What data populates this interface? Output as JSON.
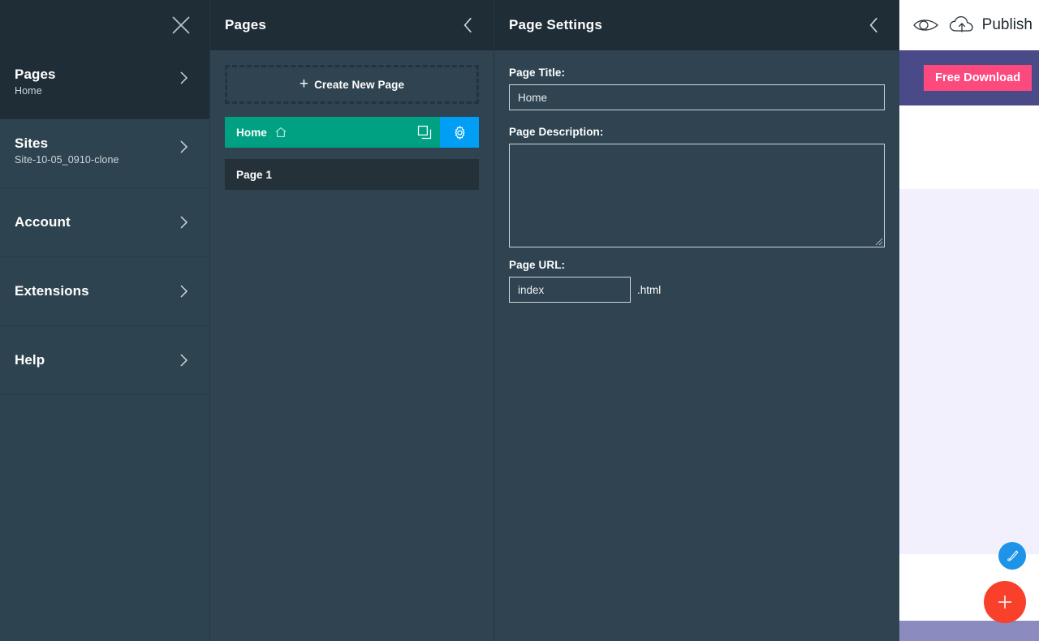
{
  "sidebar": {
    "close_icon": "close-icon",
    "items": [
      {
        "title": "Pages",
        "sub": "Home",
        "icon": "chevron-right-icon",
        "active": true
      },
      {
        "title": "Sites",
        "sub": "Site-10-05_0910-clone",
        "icon": "chevron-right-icon",
        "active": false
      },
      {
        "title": "Account",
        "sub": "",
        "icon": "chevron-right-icon",
        "active": false
      },
      {
        "title": "Extensions",
        "sub": "",
        "icon": "chevron-right-icon",
        "active": false
      },
      {
        "title": "Help",
        "sub": "",
        "icon": "chevron-right-icon",
        "active": false
      }
    ]
  },
  "pages_panel": {
    "title": "Pages",
    "back_icon": "chevron-left-icon",
    "create_new_label": "Create New Page",
    "create_new_plus": "+",
    "rows": [
      {
        "label": "Home",
        "home_icon": "home-icon",
        "duplicate_icon": "duplicate-icon",
        "settings_icon": "gear-icon",
        "selected": true
      },
      {
        "label": "Page 1",
        "selected": false
      }
    ]
  },
  "settings_panel": {
    "title": "Page Settings",
    "back_icon": "chevron-left-icon",
    "page_title_label": "Page Title:",
    "page_title_value": "Home",
    "page_title_placeholder": "Page Title",
    "page_description_label": "Page Description:",
    "page_description_value": "",
    "page_description_placeholder": "",
    "page_url_label": "Page URL:",
    "page_url_value": "index",
    "page_url_placeholder": "index",
    "page_url_extension": ".html"
  },
  "preview": {
    "preview_icon": "eye-icon",
    "publish_icon": "cloud-upload-icon",
    "publish_label": "Publish",
    "free_download_label": "Free Download",
    "brush_fab_icon": "brush-icon",
    "add_fab_icon": "plus-icon"
  },
  "colors": {
    "sidebar_bg": "#2e4350",
    "header_bg": "#1f2d36",
    "panel_bg": "#2f4350",
    "selected_page": "#00a183",
    "gear_button": "#009ff5",
    "idle_page": "#243139",
    "banner_purple": "#4b4a89",
    "free_download_pink": "#fc4a7e",
    "fab_blue": "#1f93e8",
    "fab_red": "#f8402a",
    "lavender": "#f1f0fc",
    "footer_purple": "#8b8bc0"
  }
}
